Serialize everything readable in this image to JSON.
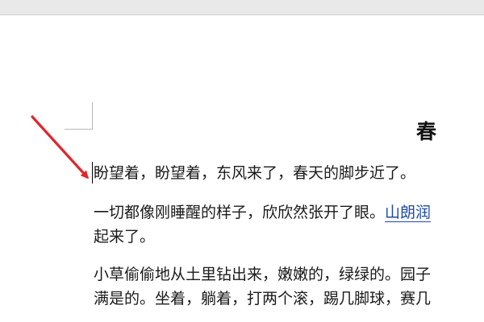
{
  "document": {
    "title": "春",
    "paragraphs": {
      "p1": "盼望着，盼望着，东风来了，春天的脚步近了。",
      "p2_line1_main": "一切都像刚睡醒的样子，欣欣然张开了眼。",
      "p2_line1_link": "山朗润",
      "p2_line2": "起来了。",
      "p3_line1": "小草偷偷地从土里钻出来，嫩嫩的，绿绿的。园子",
      "p3_line2": "满是的。坐着，躺着，打两个滚，踢几脚球，赛几"
    }
  },
  "annotation": {
    "arrow_color": "#e0262b",
    "target": "text-cursor"
  },
  "colors": {
    "link": "#1f4aa8",
    "toolbar": "#e9e9e9"
  }
}
